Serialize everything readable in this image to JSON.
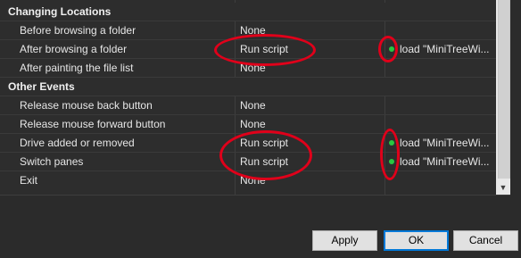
{
  "events": [
    {
      "type": "header",
      "label": "Changing Locations"
    },
    {
      "type": "item",
      "label": "Before browsing a folder",
      "action": "None",
      "detail": ""
    },
    {
      "type": "item",
      "label": "After browsing a folder",
      "action": "Run script",
      "detail": "load \"MiniTreeWi..."
    },
    {
      "type": "item",
      "label": "After painting the file list",
      "action": "None",
      "detail": ""
    },
    {
      "type": "header",
      "label": "Other Events"
    },
    {
      "type": "item",
      "label": "Release mouse back button",
      "action": "None",
      "detail": ""
    },
    {
      "type": "item",
      "label": "Release mouse forward button",
      "action": "None",
      "detail": ""
    },
    {
      "type": "item",
      "label": "Drive added or removed",
      "action": "Run script",
      "detail": "load \"MiniTreeWi..."
    },
    {
      "type": "item",
      "label": "Switch panes",
      "action": "Run script",
      "detail": "load \"MiniTreeWi..."
    },
    {
      "type": "item",
      "label": "Exit",
      "action": "None",
      "detail": ""
    }
  ],
  "buttons": {
    "apply": "Apply",
    "ok": "OK",
    "cancel": "Cancel"
  },
  "colors": {
    "annotation": "#e0001a",
    "status_dot": "#28c840",
    "background": "#2b2b2b"
  },
  "icons": {
    "scroll_down": "chevron-down-icon",
    "status": "green-dot-icon"
  }
}
